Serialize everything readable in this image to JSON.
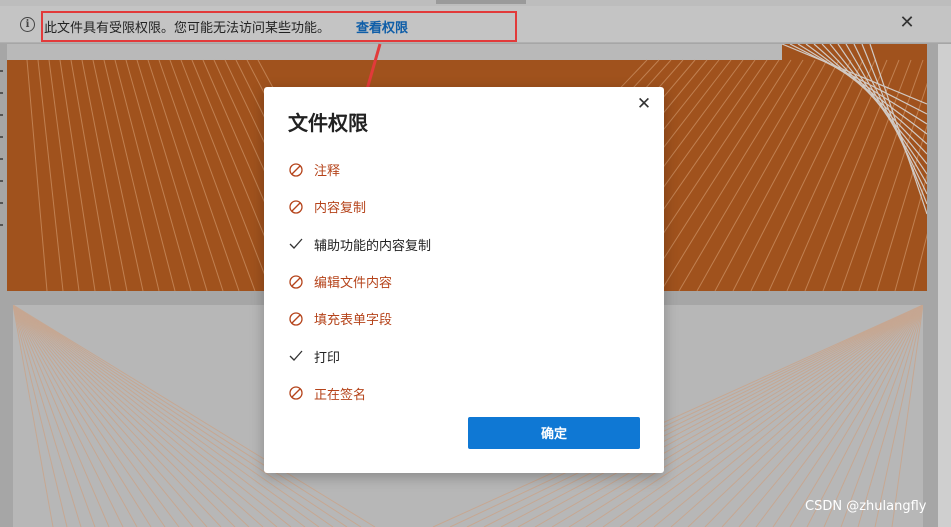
{
  "infobar": {
    "message": "此文件具有受限权限。您可能无法访问某些功能。",
    "link_label": "查看权限",
    "close_icon": "close-icon",
    "info_icon": "info-icon"
  },
  "dialog": {
    "title": "文件权限",
    "close_icon": "close-icon",
    "permissions": [
      {
        "label": "注释",
        "allowed": false
      },
      {
        "label": "内容复制",
        "allowed": false
      },
      {
        "label": "辅助功能的内容复制",
        "allowed": true
      },
      {
        "label": "编辑文件内容",
        "allowed": false
      },
      {
        "label": "填充表单字段",
        "allowed": false
      },
      {
        "label": "打印",
        "allowed": true
      },
      {
        "label": "正在签名",
        "allowed": false
      }
    ],
    "ok_label": "确定"
  },
  "watermark": "CSDN @zhulangfly",
  "colors": {
    "accent": "#0f78d4",
    "denied": "#b5431a",
    "link": "#0f5ea8",
    "annotation": "#e23a3a",
    "cover": "#a0521d"
  }
}
